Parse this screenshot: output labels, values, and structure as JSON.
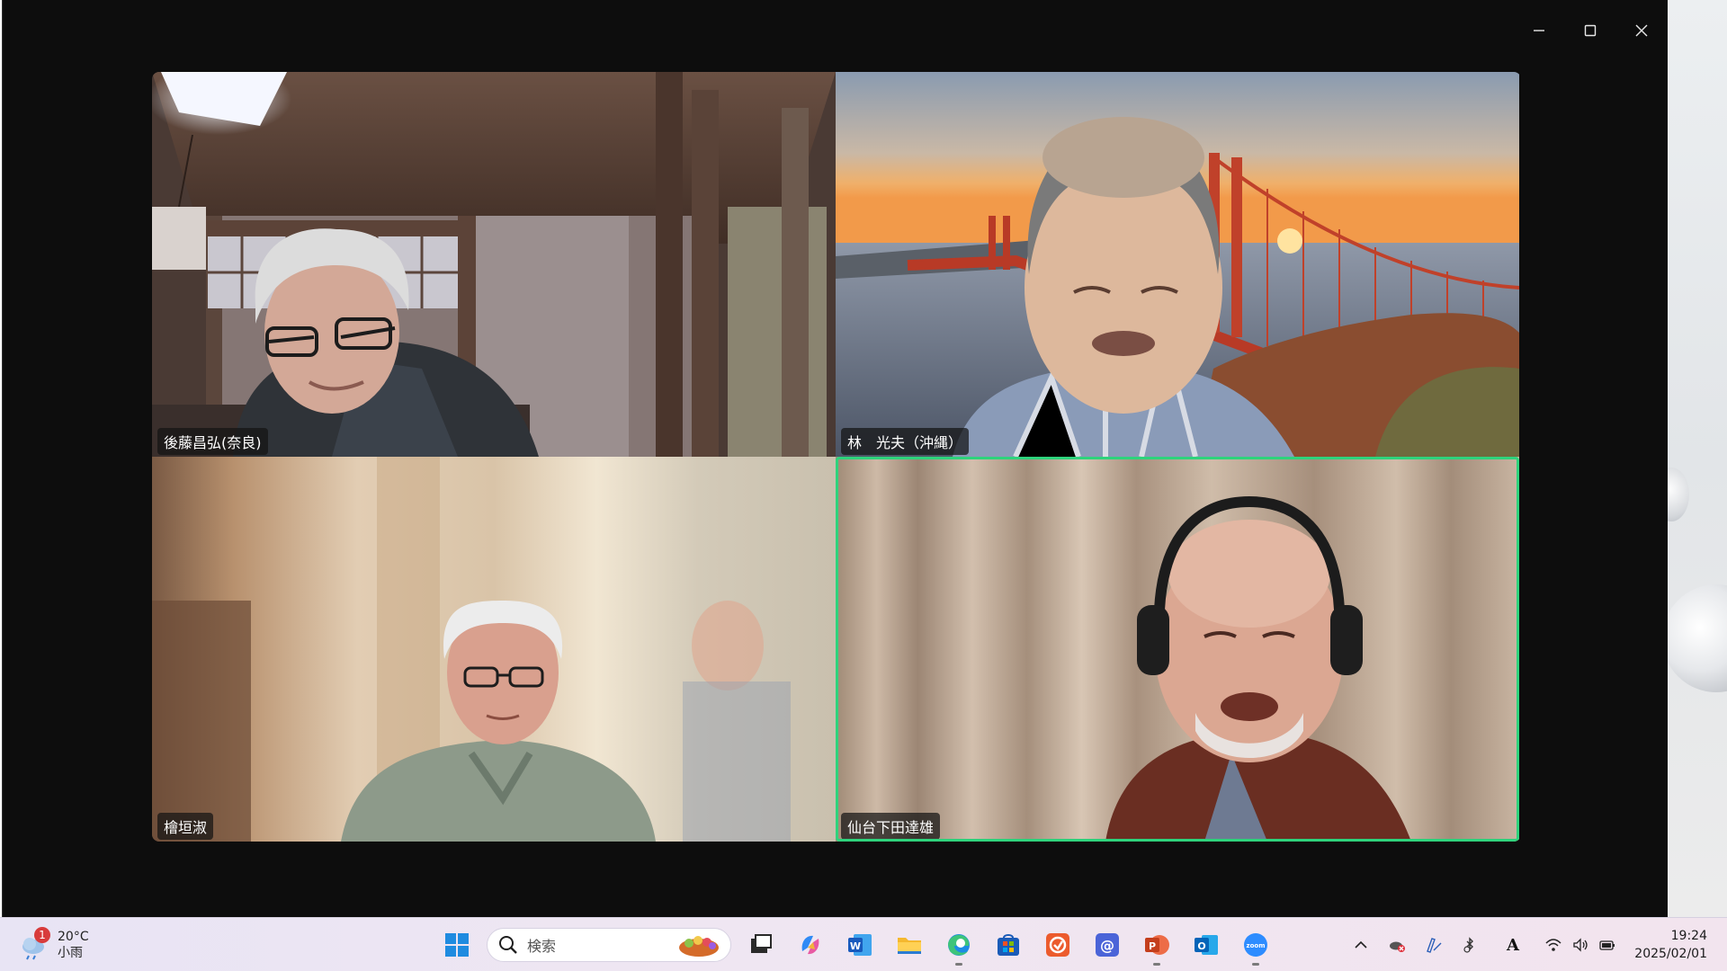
{
  "window": {
    "controls": {
      "minimize": "minimize-icon",
      "maximize": "maximize-icon",
      "close": "close-icon"
    }
  },
  "participants": [
    {
      "name": "後藤昌弘(奈良)",
      "active": false
    },
    {
      "name": "林　光夫（沖縄）",
      "active": false
    },
    {
      "name": "檜垣淑",
      "active": false
    },
    {
      "name": "仙台下田達雄",
      "active": true
    }
  ],
  "taskbar": {
    "weather": {
      "badge": "1",
      "temp": "20°C",
      "condition": "小雨"
    },
    "search_placeholder": "検索",
    "apps": [
      "start-icon",
      "task-view-icon",
      "copilot-icon",
      "word-icon",
      "file-explorer-icon",
      "edge-icon",
      "store-icon",
      "app-icon",
      "mail-icon",
      "powerpoint-icon",
      "outlook-icon",
      "zoom-icon"
    ],
    "tray": [
      "chevron-up-icon",
      "onedrive-icon",
      "pen-icon",
      "bluetooth-icon",
      "ime-icon",
      "wifi-icon",
      "volume-icon",
      "battery-icon"
    ],
    "ime_label": "A",
    "time": "19:24",
    "date": "2025/02/01"
  },
  "colors": {
    "active_speaker": "#2ed37c",
    "window_bg": "#0d0d0d"
  }
}
